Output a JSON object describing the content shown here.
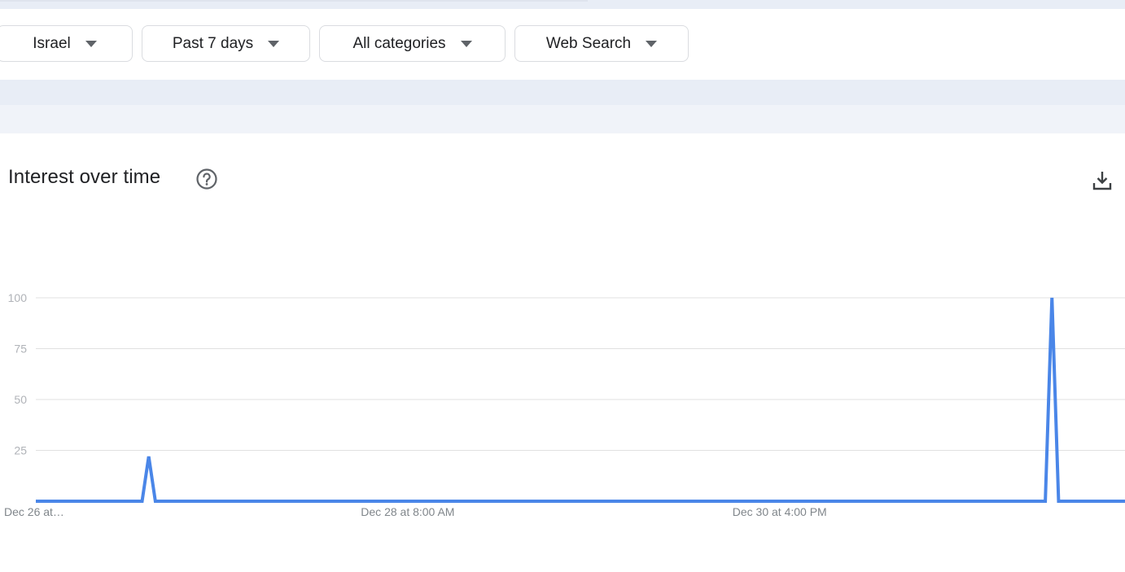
{
  "filters": [
    {
      "label": "Israel"
    },
    {
      "label": "Past 7 days"
    },
    {
      "label": "All categories"
    },
    {
      "label": "Web Search"
    }
  ],
  "section": {
    "title": "Interest over time",
    "help_icon": "help-circle-icon",
    "download_icon": "download-icon"
  },
  "colors": {
    "line": "#4a86e8",
    "grid": "#e0e0e0",
    "band": "#e8edf6"
  },
  "chart_data": {
    "type": "line",
    "title": "",
    "xlabel": "",
    "ylabel": "",
    "ylim": [
      0,
      100
    ],
    "yticks": [
      25,
      50,
      75,
      100
    ],
    "x_tick_labels": [
      {
        "label": "Dec 26 at…",
        "index": 0
      },
      {
        "label": "Dec 28 at 8:00 AM",
        "index": 56
      },
      {
        "label": "Dec 30 at 4:00 PM",
        "index": 112
      }
    ],
    "series": [
      {
        "values": [
          0,
          0,
          0,
          0,
          0,
          0,
          0,
          0,
          0,
          0,
          0,
          0,
          0,
          0,
          0,
          0,
          0,
          22,
          0,
          0,
          0,
          0,
          0,
          0,
          0,
          0,
          0,
          0,
          0,
          0,
          0,
          0,
          0,
          0,
          0,
          0,
          0,
          0,
          0,
          0,
          0,
          0,
          0,
          0,
          0,
          0,
          0,
          0,
          0,
          0,
          0,
          0,
          0,
          0,
          0,
          0,
          0,
          0,
          0,
          0,
          0,
          0,
          0,
          0,
          0,
          0,
          0,
          0,
          0,
          0,
          0,
          0,
          0,
          0,
          0,
          0,
          0,
          0,
          0,
          0,
          0,
          0,
          0,
          0,
          0,
          0,
          0,
          0,
          0,
          0,
          0,
          0,
          0,
          0,
          0,
          0,
          0,
          0,
          0,
          0,
          0,
          0,
          0,
          0,
          0,
          0,
          0,
          0,
          0,
          0,
          0,
          0,
          0,
          0,
          0,
          0,
          0,
          0,
          0,
          0,
          0,
          0,
          0,
          0,
          0,
          0,
          0,
          0,
          0,
          0,
          0,
          0,
          0,
          0,
          0,
          0,
          0,
          0,
          0,
          0,
          0,
          0,
          0,
          0,
          0,
          0,
          0,
          0,
          0,
          0,
          0,
          0,
          0,
          100,
          0,
          0,
          0,
          0,
          0,
          0,
          0,
          0,
          0,
          0,
          0
        ]
      }
    ],
    "grid": true,
    "legend": "none"
  }
}
